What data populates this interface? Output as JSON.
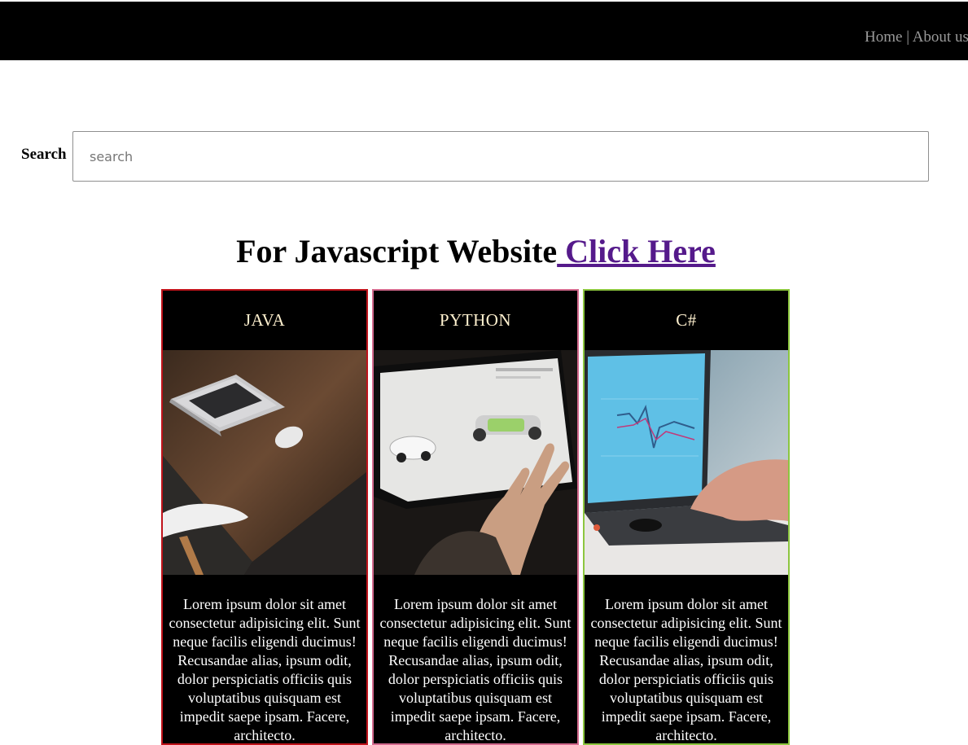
{
  "nav": {
    "home": "Home",
    "separator": "|",
    "about": "About us"
  },
  "search": {
    "label": "Search",
    "placeholder": "search",
    "value": ""
  },
  "headline": {
    "text": "For Javascript Website",
    "link": " Click Here"
  },
  "cards": [
    {
      "title": "JAVA",
      "image": "laptop-on-wooden-desk-photo",
      "border_color": "#c0131b",
      "text": "Lorem ipsum dolor sit amet consectetur adipisicing elit. Sunt neque facilis eligendi ducimus! Recusandae alias, ipsum odit, dolor perspiciatis officiis quis voluptatibus quisquam est impedit saepe ipsam. Facere, architecto."
    },
    {
      "title": "PYTHON",
      "image": "tablet-car-configurator-photo",
      "border_color": "#d46a8e",
      "text": "Lorem ipsum dolor sit amet consectetur adipisicing elit. Sunt neque facilis eligendi ducimus! Recusandae alias, ipsum odit, dolor perspiciatis officiis quis voluptatibus quisquam est impedit saepe ipsam. Facere, architecto."
    },
    {
      "title": "C#",
      "image": "laptop-with-chart-photo",
      "border_color": "#8cc63f",
      "text": "Lorem ipsum dolor sit amet consectetur adipisicing elit. Sunt neque facilis eligendi ducimus! Recusandae alias, ipsum odit, dolor perspiciatis officiis quis voluptatibus quisquam est impedit saepe ipsam. Facere, architecto."
    }
  ]
}
